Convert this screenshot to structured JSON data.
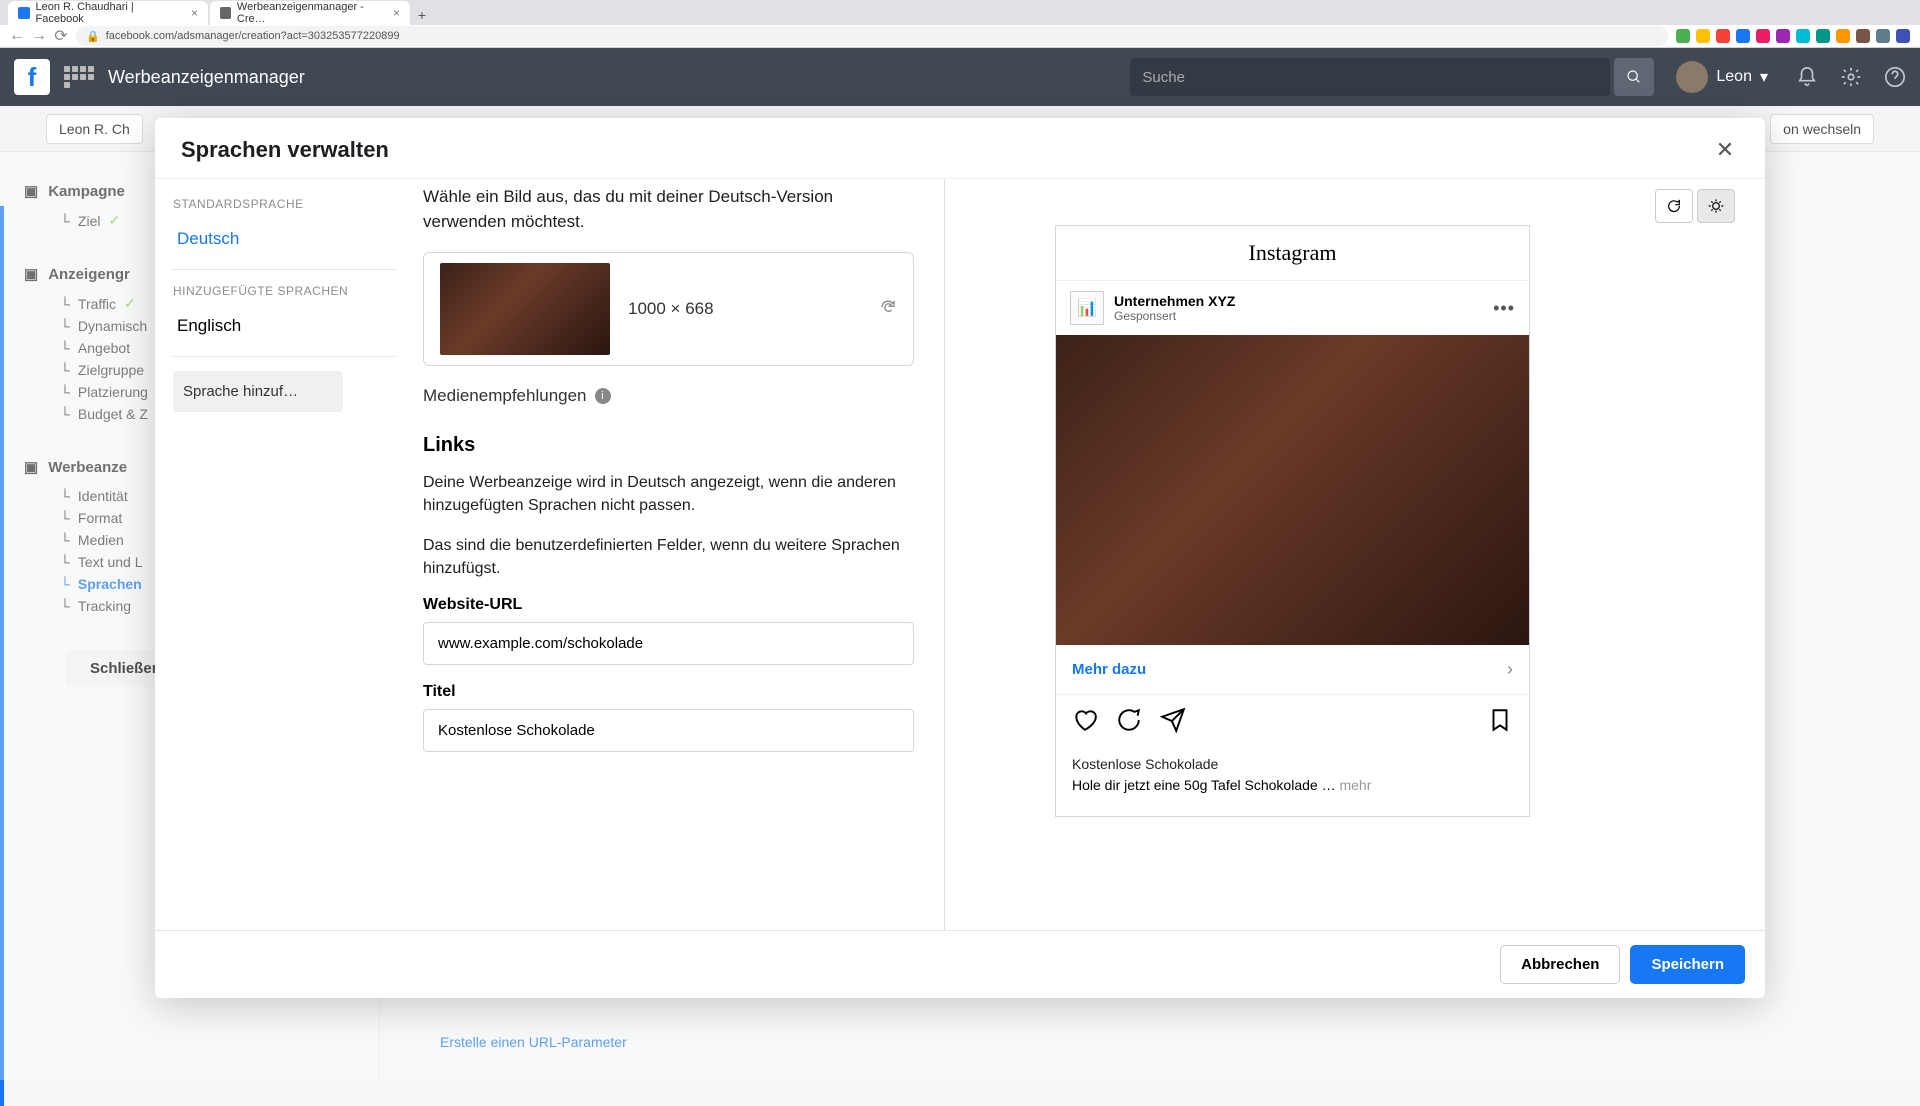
{
  "browser": {
    "tabs": [
      {
        "title": "Leon R. Chaudhari | Facebook"
      },
      {
        "title": "Werbeanzeigenmanager - Cre…"
      }
    ],
    "url": "facebook.com/adsmanager/creation?act=303253577220899"
  },
  "topnav": {
    "app_title": "Werbeanzeigenmanager",
    "search_placeholder": "Suche",
    "user_name": "Leon"
  },
  "page_bg": {
    "account_chip": "Leon R. Ch",
    "switch_btn": "on wechseln",
    "rail": {
      "campaign": "Kampagne",
      "ziel": "Ziel",
      "adgroup": "Anzeigengr",
      "traffic": "Traffic",
      "dynamic": "Dynamisch",
      "angebot": "Angebot",
      "zielgruppe": "Zielgruppe",
      "platzierung": "Platzierung",
      "budget": "Budget & Z",
      "ad": "Werbeanze",
      "identitat": "Identität",
      "format": "Format",
      "medien": "Medien",
      "textundl": "Text und L",
      "sprachen": "Sprachen",
      "tracking": "Tracking",
      "close": "Schließen"
    },
    "url_param_link": "Erstelle einen URL-Parameter"
  },
  "modal": {
    "title": "Sprachen verwalten",
    "sidebar": {
      "default_label": "Standardsprache",
      "default_lang": "Deutsch",
      "added_label": "Hinzugefügte Sprachen",
      "added_lang": "Englisch",
      "add_btn": "Sprache hinzuf…"
    },
    "center": {
      "instruction": "Wähle ein Bild aus, das du mit deiner Deutsch-Version verwenden möchtest.",
      "image_dims": "1000 × 668",
      "media_rec": "Medienempfehlungen",
      "links_heading": "Links",
      "links_para1": "Deine Werbeanzeige wird in Deutsch angezeigt, wenn die anderen hinzugefügten Sprachen nicht passen.",
      "links_para2": "Das sind die benutzerdefinierten Felder, wenn du weitere Sprachen hinzufügst.",
      "url_label": "Website-URL",
      "url_value": "www.example.com/schokolade",
      "title_label": "Titel",
      "title_value": "Kostenlose Schokolade"
    },
    "preview": {
      "platform": "Instagram",
      "advertiser": "Unternehmen XYZ",
      "sponsored": "Gesponsert",
      "cta": "Mehr dazu",
      "caption_title": "Kostenlose Schokolade",
      "caption_body": "Hole dir jetzt eine 50g Tafel Schokolade … ",
      "more": "mehr"
    },
    "footer": {
      "cancel": "Abbrechen",
      "save": "Speichern"
    }
  }
}
